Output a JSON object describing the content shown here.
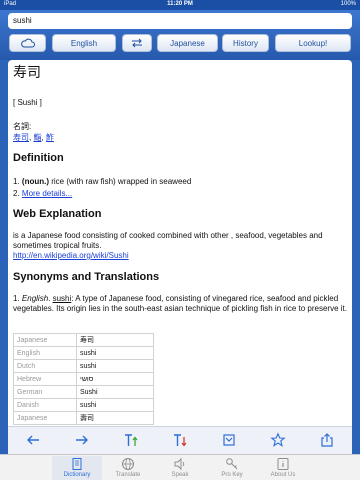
{
  "status_bar": {
    "carrier": "iPad",
    "time": "11:20 PM",
    "battery": "100%"
  },
  "search": {
    "value": "sushi"
  },
  "toolbar": {
    "source_language": "English",
    "swap_icon": "swap-icon",
    "target_language": "Japanese",
    "history_label": "History",
    "lookup_label": "Lookup!"
  },
  "entry": {
    "headword": "寿司",
    "reading": "[ Sushi ]",
    "pos_label": "名詞:",
    "forms": [
      "寿司",
      "鮨",
      "鮓"
    ],
    "definition_heading": "Definition",
    "definitions": [
      {
        "num": "1.",
        "pos": "(noun.)",
        "text": " rice (with raw fish) wrapped in seaweed"
      },
      {
        "num": "2.",
        "link": "More details..."
      }
    ],
    "web_heading": "Web Explanation",
    "web_text": "is a Japanese food consisting of cooked combined with other , seafood, vegetables and sometimes tropical fruits.",
    "web_link": "http://en.wikipedia.org/wiki/Sushi",
    "syn_heading": "Synonyms and Translations",
    "syn_num": "1.",
    "syn_lang": "English",
    "syn_word": "sushi",
    "syn_text": ": A type of Japanese food, consisting of vinegared rice, seafood and pickled vegetables. Its origin lies in the south-east asian technique of pickling fish in rice to preserve it.",
    "translations": [
      {
        "lang": "Japanese",
        "word": "寿司"
      },
      {
        "lang": "English",
        "word": "sushi"
      },
      {
        "lang": "Dutch",
        "word": "sushi"
      },
      {
        "lang": "Hebrew",
        "word": "סושי"
      },
      {
        "lang": "German",
        "word": "Sushi"
      },
      {
        "lang": "Danish",
        "word": "sushi"
      },
      {
        "lang": "Japanese",
        "word": "壽司"
      }
    ]
  },
  "bottom_toolbar": [
    "back-arrow-icon",
    "forward-arrow-icon",
    "text-larger-icon",
    "text-smaller-icon",
    "save-icon",
    "favorite-star-icon",
    "share-icon"
  ],
  "tabs": [
    {
      "label": "Dictionary",
      "icon": "book-icon",
      "active": true
    },
    {
      "label": "Translate",
      "icon": "globe-icon"
    },
    {
      "label": "Speak",
      "icon": "speaker-icon"
    },
    {
      "label": "Pro Key",
      "icon": "key-icon"
    },
    {
      "label": "About Us",
      "icon": "info-icon"
    }
  ],
  "colors": {
    "bar_blue": "#2a63b8",
    "link": "#1c3fd6",
    "accent_green": "#3aa63a",
    "accent_red": "#d23a3a"
  }
}
